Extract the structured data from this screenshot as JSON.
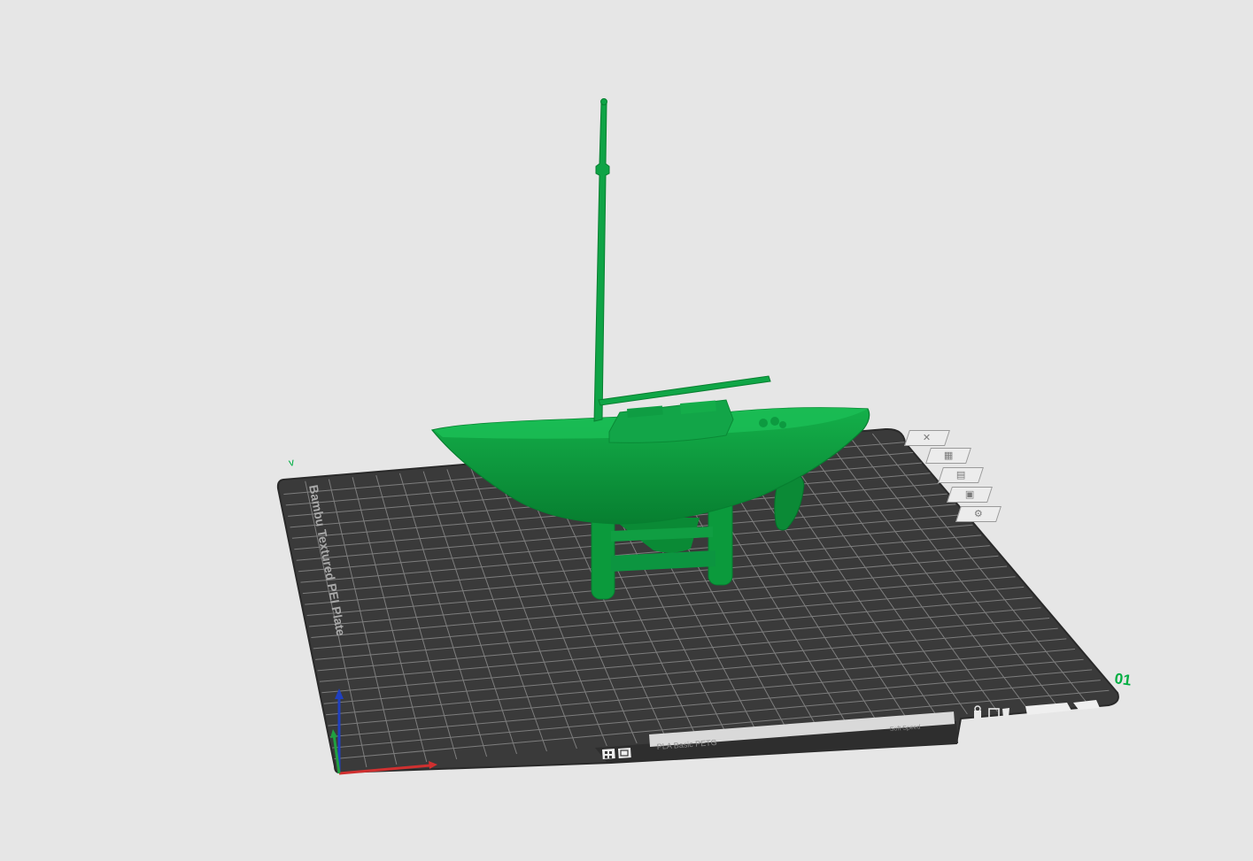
{
  "plate": {
    "name": "Bambu Textured PEI Plate",
    "number": "01",
    "corner_mark": "v",
    "filament_label": "PLA  Basic  PETG",
    "filament_sub": "Soft  Speed",
    "bottom_icons": [
      "grid-icon",
      "image-icon"
    ],
    "right_icons": [
      "lock-icon",
      "square-icon",
      "tag-icon"
    ]
  },
  "plate_toolbar": [
    {
      "name": "delete-plate",
      "icon": "close-icon",
      "glyph": "✕"
    },
    {
      "name": "arrange",
      "icon": "arrange-icon",
      "glyph": "▦"
    },
    {
      "name": "orient",
      "icon": "orient-icon",
      "glyph": "▤"
    },
    {
      "name": "lock-plate",
      "icon": "lock-icon",
      "glyph": "▣"
    },
    {
      "name": "plate-settings",
      "icon": "gear-icon",
      "glyph": "⚙"
    }
  ],
  "model": {
    "name": "sailboat",
    "color": "#0a9b3c"
  },
  "colors": {
    "background": "#e6e6e6",
    "plate": "#3a3a3a",
    "grid": "#8a8a8a",
    "accent": "#00ae42",
    "axis_x": "#d03030",
    "axis_y": "#20a040",
    "axis_z": "#2040c0"
  }
}
